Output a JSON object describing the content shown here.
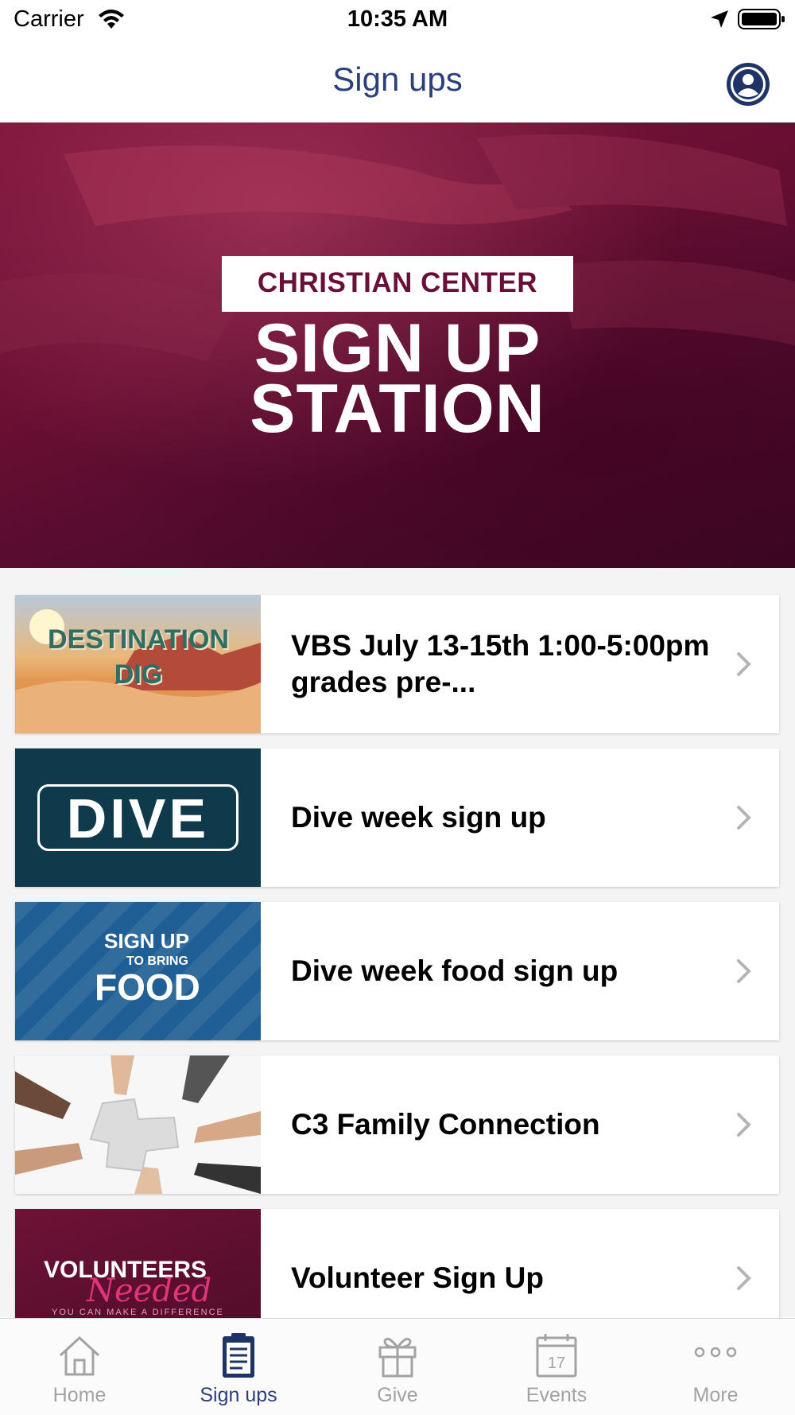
{
  "status_bar": {
    "carrier": "Carrier",
    "time": "10:35 AM"
  },
  "nav": {
    "title": "Sign ups",
    "profile_icon": "person-circle-icon"
  },
  "hero": {
    "org_name": "CHRISTIAN CENTER",
    "title_line1": "SIGN UP",
    "title_line2": "STATION"
  },
  "signups": [
    {
      "title": "VBS July 13-15th 1:00-5:00pm grades pre-...",
      "thumb_text": "DESTINATION DIG"
    },
    {
      "title": "Dive week sign up",
      "thumb_text": "DIVE"
    },
    {
      "title": "Dive week food sign up",
      "thumb_text_1": "SIGN UP",
      "thumb_text_2": "TO BRING",
      "thumb_text_3": "FOOD"
    },
    {
      "title": "C3 Family Connection"
    },
    {
      "title": "Volunteer Sign Up",
      "thumb_text_1": "VOLUNTEERS",
      "thumb_text_2": "Needed",
      "thumb_text_3": "YOU CAN MAKE A DIFFERENCE"
    }
  ],
  "tabs": [
    {
      "label": "Home",
      "icon": "home-icon"
    },
    {
      "label": "Sign ups",
      "icon": "clipboard-icon",
      "active": true
    },
    {
      "label": "Give",
      "icon": "gift-icon"
    },
    {
      "label": "Events",
      "icon": "calendar-icon",
      "icon_text": "17"
    },
    {
      "label": "More",
      "icon": "more-dots-icon"
    }
  ],
  "colors": {
    "accent": "#2c3f7c",
    "inactive": "#a3a3a3",
    "hero": "#6a0f33"
  }
}
